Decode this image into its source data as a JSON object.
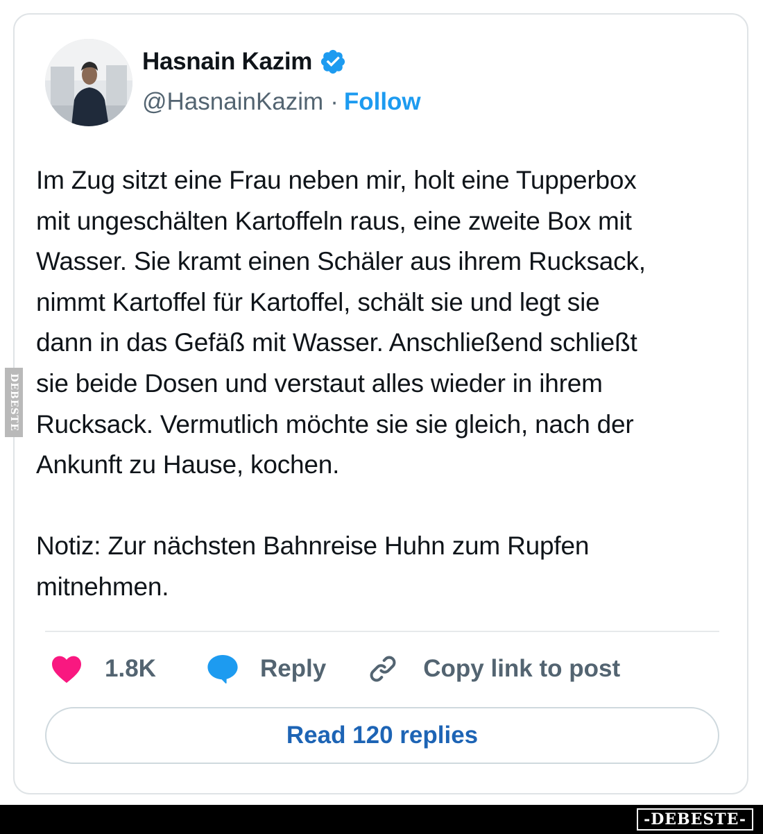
{
  "author": {
    "display_name": "Hasnain Kazim",
    "handle": "@HasnainKazim",
    "separator": "·",
    "follow_label": "Follow",
    "verified_icon": "verified-badge-icon"
  },
  "tweet": {
    "text": "Im Zug sitzt eine Frau neben mir, holt eine Tupperbox\nmit ungeschälten Kartoffeln raus, eine zweite Box mit\nWasser. Sie kramt einen Schäler aus ihrem Rucksack,\nnimmt Kartoffel für Kartoffel, schält sie und legt sie\ndann in das Gefäß mit Wasser. Anschließend schließt\nsie beide Dosen und verstaut alles wieder in ihrem\nRucksack. Vermutlich möchte sie sie gleich, nach der\nAnkunft zu Hause, kochen.\n\nNotiz: Zur nächsten Bahnreise Huhn zum Rupfen\nmitnehmen."
  },
  "actions": {
    "like_count": "1.8K",
    "reply_label": "Reply",
    "copy_link_label": "Copy link to post",
    "read_replies_label": "Read 120 replies"
  },
  "watermark": {
    "side_text": "DEBESTE",
    "footer_logo": "-DEBESTE-"
  },
  "colors": {
    "link_blue": "#1d9bf0",
    "heart_pink": "#f91880",
    "reply_blue": "#1d9bf0",
    "read_replies_text": "#1d64b5",
    "muted_text": "#536471"
  }
}
